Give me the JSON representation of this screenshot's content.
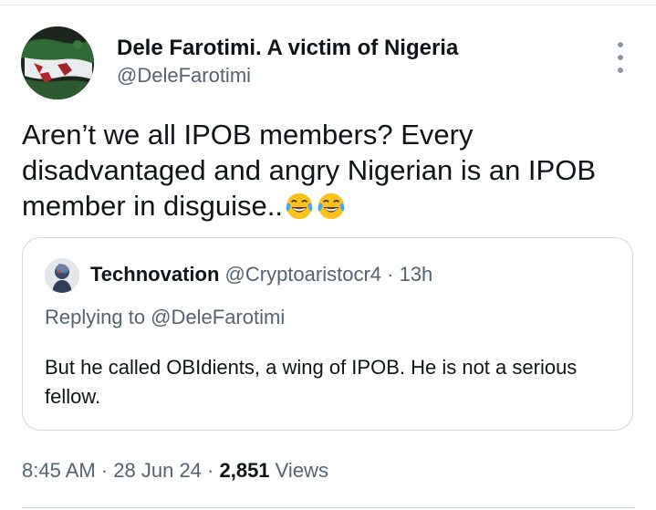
{
  "author": {
    "name": "Dele Farotimi. A victim of Nigeria",
    "handle": "@DeleFarotimi"
  },
  "tweet": {
    "text": "Aren’t we all IPOB members? Every disadvantaged and angry Nigerian is an IPOB member in disguise..",
    "emojis": [
      "face-with-tears-of-joy-icon",
      "face-with-tears-of-joy-icon"
    ]
  },
  "quote": {
    "author_name": "Technovation",
    "author_handle": "@Cryptoaristocr4",
    "separator": " · ",
    "time": "13h",
    "replying_to": "Replying to @DeleFarotimi",
    "text": "But he called OBIdients, a wing of IPOB. He is not a serious fellow."
  },
  "meta": {
    "time": "8:45 AM",
    "sep1": " · ",
    "date": "28 Jun 24",
    "sep2": " · ",
    "views_count": "2,851",
    "views_label": " Views"
  },
  "icons": {
    "more": "more-vertical-icon"
  },
  "colors": {
    "primary_text": "#0f1419",
    "secondary_text": "#536471",
    "border": "#cfd9de"
  }
}
